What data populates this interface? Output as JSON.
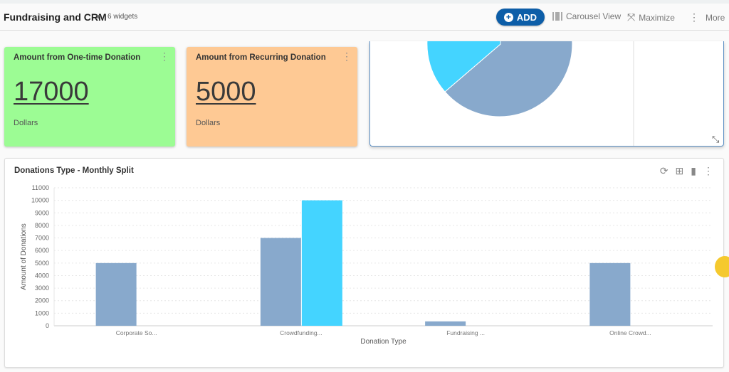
{
  "header": {
    "title": "Fundraising and CRM",
    "widget_count": "6 widgets",
    "add_label": "ADD",
    "carousel_label": "Carousel View",
    "maximize_label": "Maximize",
    "more_label": "More"
  },
  "cards": [
    {
      "title": "Amount from One-time Donation",
      "value": "17000",
      "unit": "Dollars",
      "color": "#9cfc94"
    },
    {
      "title": "Amount from Recurring Donation",
      "value": "5000",
      "unit": "Dollars",
      "color": "#fec994"
    }
  ],
  "colors": {
    "accent": "#0d5ea8",
    "series1": "#88a9cc",
    "series2": "#44d4ff"
  },
  "chart_data": {
    "type": "bar",
    "title": "Donations Type - Monthly Split",
    "xlabel": "Donation Type",
    "ylabel": "Amount of Donations",
    "ylim": [
      0,
      11000
    ],
    "yticks": [
      0,
      1000,
      2000,
      3000,
      4000,
      5000,
      6000,
      7000,
      8000,
      9000,
      10000,
      11000
    ],
    "grid": true,
    "categories": [
      "Corporate So...",
      "Crowdfunding...",
      "Fundraising ...",
      "Online Crowd..."
    ],
    "series": [
      {
        "values": [
          5000,
          7000,
          350,
          5000
        ],
        "color": "#88a9cc"
      },
      {
        "values": [
          0,
          10000,
          0,
          0
        ],
        "color": "#44d4ff"
      }
    ]
  }
}
